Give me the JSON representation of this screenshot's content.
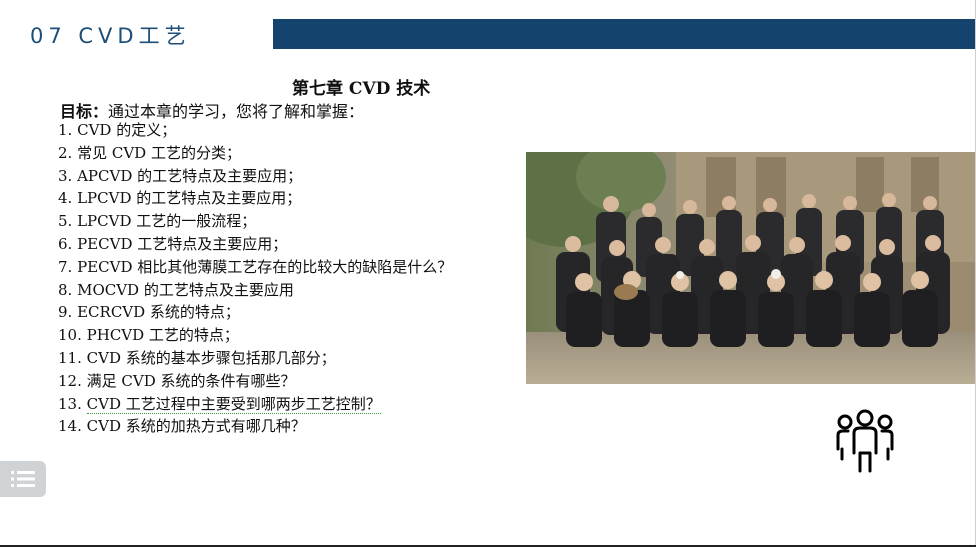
{
  "header": {
    "section_title": "07 CVD工艺",
    "bar_color": "#14446e",
    "title_color": "#1d4e77"
  },
  "content": {
    "chapter_title": "第七章 CVD 技术",
    "objective_lead": "目标：",
    "objective_text": "通过本章的学习，您将了解和掌握：",
    "items": [
      {
        "num": "1.",
        "text": "CVD 的定义；"
      },
      {
        "num": "2.",
        "text": "常见 CVD 工艺的分类；"
      },
      {
        "num": "3.",
        "text": "APCVD 的工艺特点及主要应用；"
      },
      {
        "num": "4.",
        "text": "LPCVD 的工艺特点及主要应用；"
      },
      {
        "num": "5.",
        "text": "LPCVD 工艺的一般流程；"
      },
      {
        "num": "6.",
        "text": "PECVD 工艺特点及主要应用；"
      },
      {
        "num": "7.",
        "text": "PECVD 相比其他薄膜工艺存在的比较大的缺陷是什么？"
      },
      {
        "num": "8.",
        "text": "MOCVD 的工艺特点及主要应用"
      },
      {
        "num": "9.",
        "text": "ECRCVD 系统的特点；"
      },
      {
        "num": "10.",
        "text": "PHCVD 工艺的特点；"
      },
      {
        "num": "11.",
        "text": "CVD 系统的基本步骤包括那几部分；"
      },
      {
        "num": "12.",
        "text": "满足 CVD 系统的条件有哪些？"
      },
      {
        "num": "13.",
        "text": "CVD 工艺过程中主要受到哪两步工艺控制？"
      },
      {
        "num": "14.",
        "text": "CVD 系统的加热方式有哪几种？"
      }
    ]
  },
  "icons": {
    "people": "people-group-icon",
    "menu": "list-menu-icon"
  }
}
